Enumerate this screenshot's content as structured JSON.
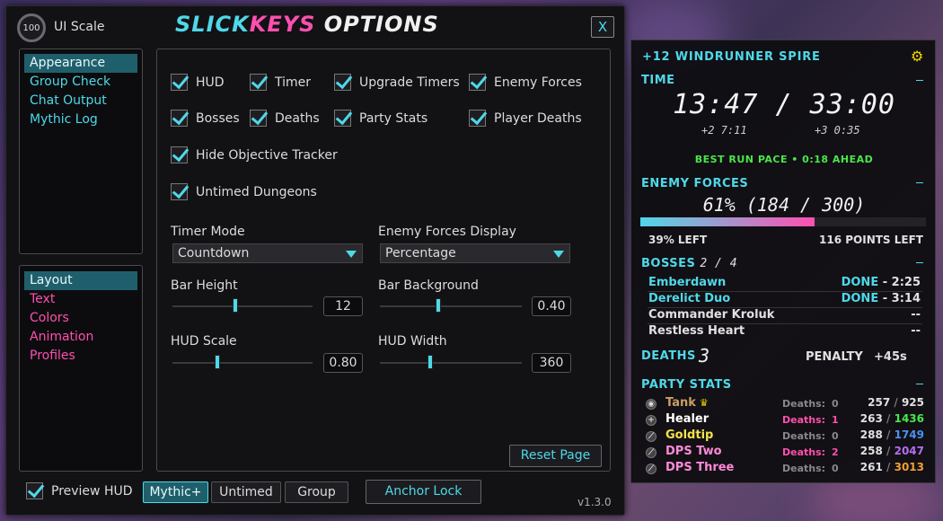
{
  "options": {
    "ui_scale_value": "100",
    "ui_scale_label": "UI Scale",
    "title_part1": "SLICK",
    "title_part2": "KEYS",
    "title_part3": " OPTIONS",
    "close_label": "X",
    "nav_top": [
      "Appearance",
      "Group Check",
      "Chat Output",
      "Mythic Log"
    ],
    "nav_bottom": [
      "Layout",
      "Text",
      "Colors",
      "Animation",
      "Profiles"
    ],
    "checkboxes": {
      "hud": "HUD",
      "timer": "Timer",
      "upgrade_timers": "Upgrade Timers",
      "enemy_forces": "Enemy Forces",
      "bosses": "Bosses",
      "deaths": "Deaths",
      "party_stats": "Party Stats",
      "player_deaths": "Player Deaths",
      "hide_objective": "Hide Objective Tracker",
      "untimed": "Untimed Dungeons"
    },
    "timer_mode_label": "Timer Mode",
    "timer_mode_value": "Countdown",
    "forces_display_label": "Enemy Forces Display",
    "forces_display_value": "Percentage",
    "bar_height_label": "Bar Height",
    "bar_height_value": "12",
    "bar_bg_label": "Bar Background",
    "bar_bg_value": "0.40",
    "hud_scale_label": "HUD Scale",
    "hud_scale_value": "0.80",
    "hud_width_label": "HUD Width",
    "hud_width_value": "360",
    "reset_label": "Reset Page",
    "preview_label": "Preview HUD",
    "mode_tabs": [
      "Mythic+",
      "Untimed",
      "Group"
    ],
    "anchor_label": "Anchor Lock",
    "version": "v1.3.0"
  },
  "hud": {
    "title": "+12 WINDRUNNER SPIRE",
    "time_label": "TIME",
    "time_value": "13:47 / 33:00",
    "split_plus2": "+2  7:11",
    "split_plus3": "+3  0:35",
    "best_pace": "BEST RUN PACE  •  0:18 AHEAD",
    "forces_label": "ENEMY FORCES",
    "forces_value": "61%  (184 / 300)",
    "forces_fraction": 0.61,
    "forces_left_pct": "39% LEFT",
    "forces_left_points": "116 POINTS LEFT",
    "bosses_label": "BOSSES",
    "bosses_count": "2 / 4",
    "bosses": [
      {
        "name": "Emberdawn",
        "status": "DONE",
        "time": " - 2:25",
        "color": "#4fd8e8"
      },
      {
        "name": "Derelict Duo",
        "status": "DONE",
        "time": " - 3:14",
        "color": "#4fd8e8"
      },
      {
        "name": "Commander Kroluk",
        "status": "",
        "time": "--",
        "color": "#e0e0e0"
      },
      {
        "name": "Restless Heart",
        "status": "",
        "time": "--",
        "color": "#e0e0e0"
      }
    ],
    "deaths_label": "DEATHS",
    "deaths_value": "3",
    "penalty_label": "PENALTY",
    "penalty_value": "+45s",
    "party_label": "PARTY STATS",
    "deaths_col": "Deaths:",
    "party": [
      {
        "name": "Tank",
        "deaths": "0",
        "cur": "257",
        "max": "925",
        "name_color": "#c8a064",
        "deaths_color": "#888",
        "max_color": "#e0e0e0",
        "icon": "shield-icon",
        "crown": "♛"
      },
      {
        "name": "Healer",
        "deaths": "1",
        "cur": "263",
        "max": "1436",
        "name_color": "#ffffff",
        "deaths_color": "#ff4fb0",
        "max_color": "#4ae64a",
        "icon": "cross-icon",
        "crown": ""
      },
      {
        "name": "Goldtip",
        "deaths": "0",
        "cur": "288",
        "max": "1749",
        "name_color": "#f2e24a",
        "deaths_color": "#888",
        "max_color": "#4f8ff0",
        "icon": "sword-icon",
        "crown": ""
      },
      {
        "name": "DPS Two",
        "deaths": "2",
        "cur": "258",
        "max": "2047",
        "name_color": "#ff8ad8",
        "deaths_color": "#ff4fb0",
        "max_color": "#b46ef0",
        "icon": "sword-icon",
        "crown": ""
      },
      {
        "name": "DPS Three",
        "deaths": "0",
        "cur": "261",
        "max": "3013",
        "name_color": "#ff8ad8",
        "deaths_color": "#888",
        "max_color": "#f0a030",
        "icon": "sword-icon",
        "crown": ""
      }
    ]
  }
}
